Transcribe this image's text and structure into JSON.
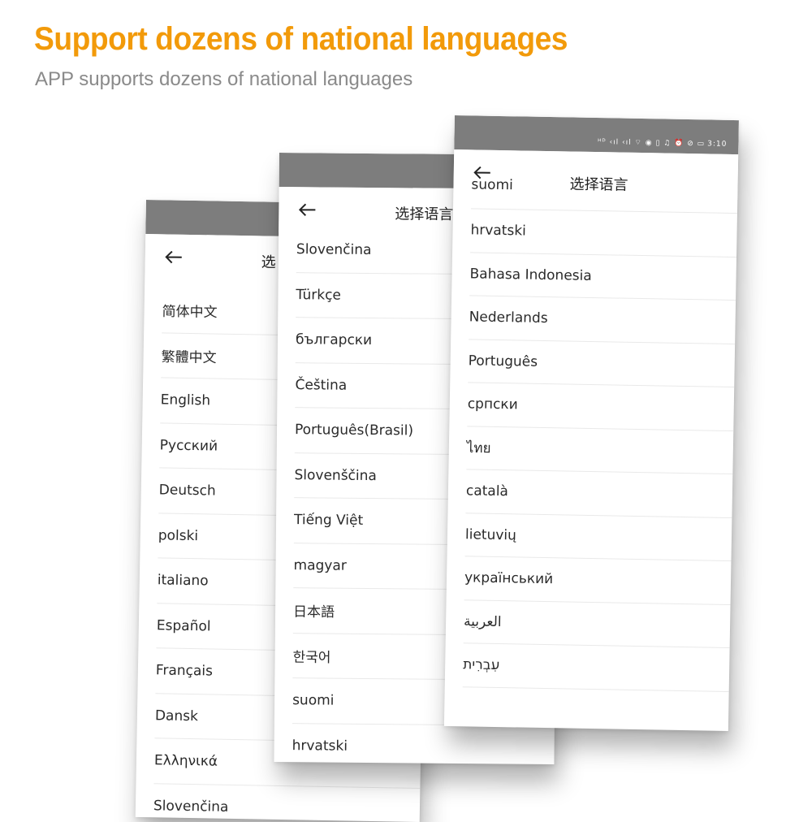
{
  "header": {
    "title": "Support dozens of national languages",
    "subtitle": "APP supports dozens of national languages",
    "title_color": "#f29a0a"
  },
  "status_bar": {
    "icons": [
      "hd-icon",
      "signal-icon",
      "wifi-icon",
      "alarm-icon",
      "mute-icon",
      "battery-icon"
    ],
    "time": "3:10"
  },
  "screen_title": "选择语言",
  "phones": [
    {
      "title_visible": "选",
      "languages": [
        "简体中文",
        "繁體中文",
        "English",
        "Русский",
        "Deutsch",
        "polski",
        "italiano",
        "Español",
        "Français",
        "Dansk",
        "Ελληνικά",
        "Slovenčina"
      ]
    },
    {
      "title_visible": "选择语言",
      "languages": [
        "Slovenčina",
        "Türkçe",
        "български",
        "Čeština",
        "Português(Brasil)",
        "Slovenščina",
        "Tiếng Việt",
        "magyar",
        "日本語",
        "한국어",
        "suomi",
        "hrvatski"
      ]
    },
    {
      "title_visible": "选择语言",
      "languages": [
        "suomi",
        "hrvatski",
        "Bahasa Indonesia",
        "Nederlands",
        "Português",
        "српски",
        "ไทย",
        "català",
        "lietuvių",
        "український",
        "العربية",
        "עִבְרִית"
      ]
    }
  ]
}
